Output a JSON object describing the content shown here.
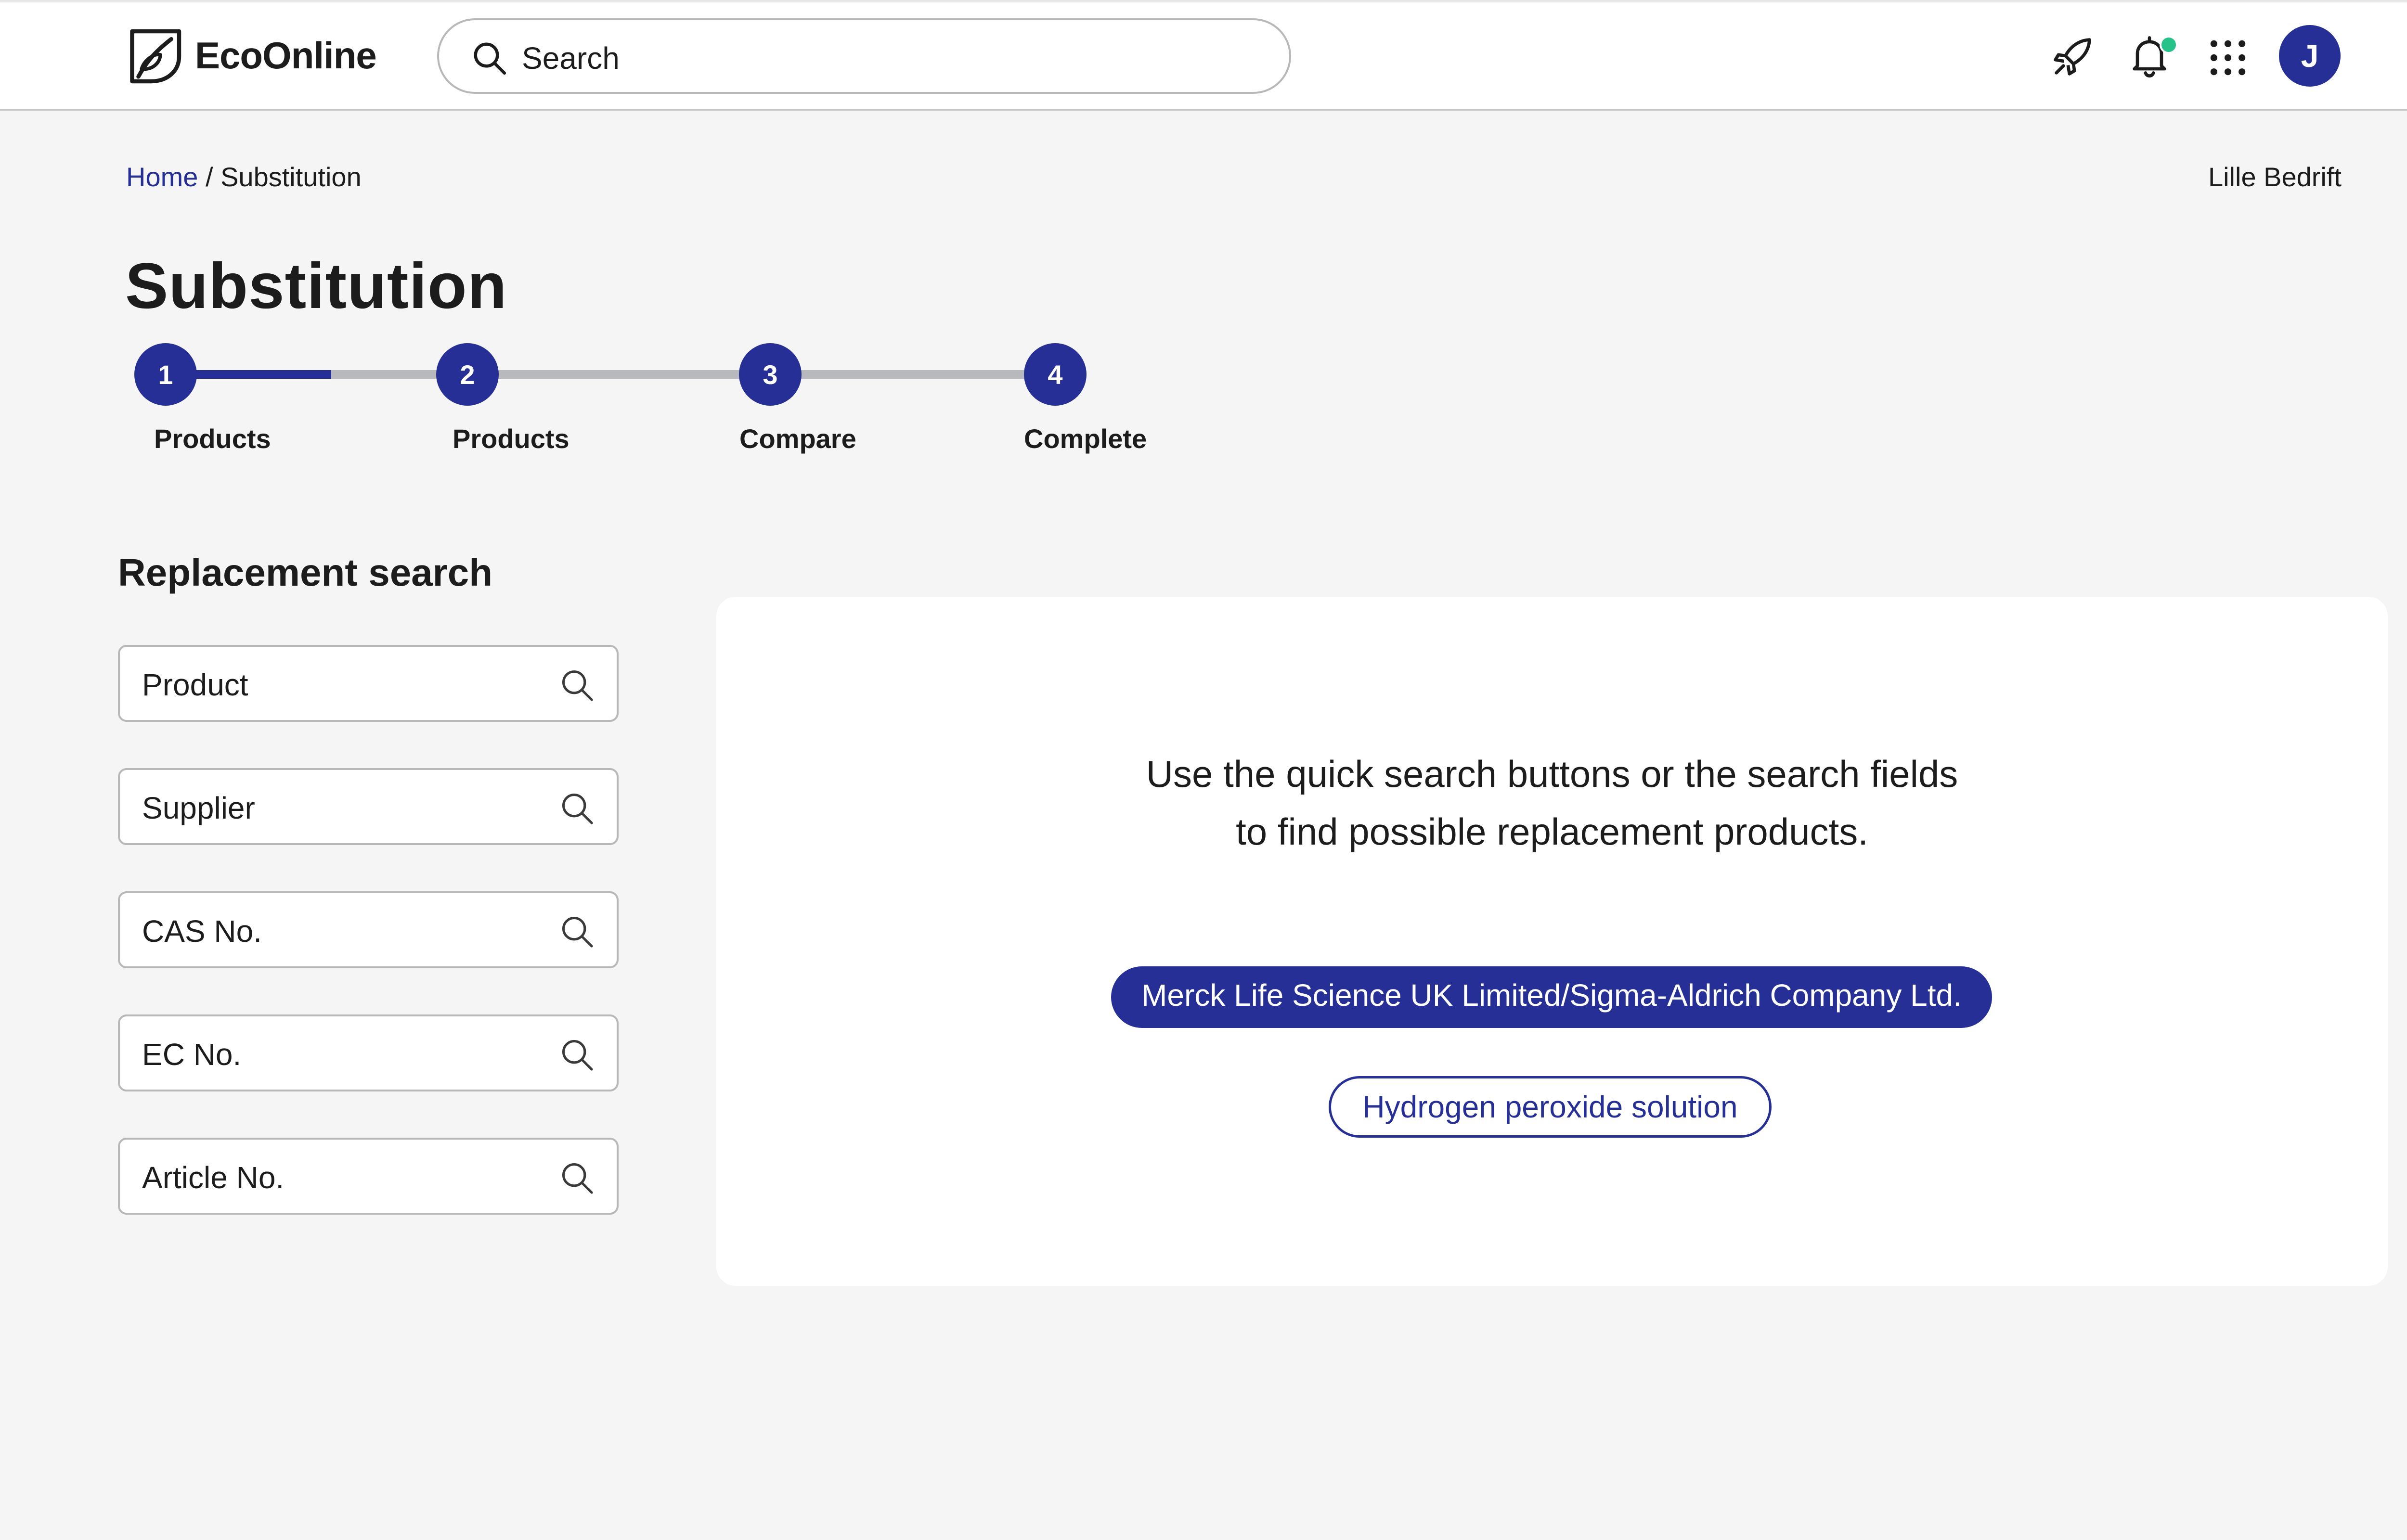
{
  "app": {
    "brand": "EcoOnline"
  },
  "header": {
    "search_placeholder": "Search",
    "icons": [
      "rocket-icon",
      "bell-icon",
      "apps-grid-icon"
    ],
    "notification_dot_color": "#25c28a",
    "avatar_initial": "J"
  },
  "breadcrumb": {
    "home": "Home",
    "separator": "/",
    "current": "Substitution"
  },
  "company": "Lille Bedrift",
  "page": {
    "title": "Substitution"
  },
  "stepper": {
    "progress_in_step_1": 0.55,
    "steps": [
      {
        "number": "1",
        "label": "Products"
      },
      {
        "number": "2",
        "label": "Products"
      },
      {
        "number": "3",
        "label": "Compare"
      },
      {
        "number": "4",
        "label": "Complete"
      }
    ]
  },
  "replacement_search": {
    "title": "Replacement search",
    "fields": [
      {
        "placeholder": "Product"
      },
      {
        "placeholder": "Supplier"
      },
      {
        "placeholder": "CAS No."
      },
      {
        "placeholder": "EC No."
      },
      {
        "placeholder": "Article No."
      }
    ]
  },
  "results": {
    "hint_line1": "Use the quick search buttons or the search fields",
    "hint_line2": "to find possible replacement products.",
    "quick_buttons": [
      {
        "label": "Merck Life Science UK Limited/Sigma-Aldrich Company Ltd.",
        "style": "filled"
      },
      {
        "label": "Hydrogen peroxide solution",
        "style": "outline"
      }
    ]
  },
  "colors": {
    "accent": "#262f96",
    "background": "#f5f5f5",
    "track_inactive": "#b8b9bd"
  }
}
